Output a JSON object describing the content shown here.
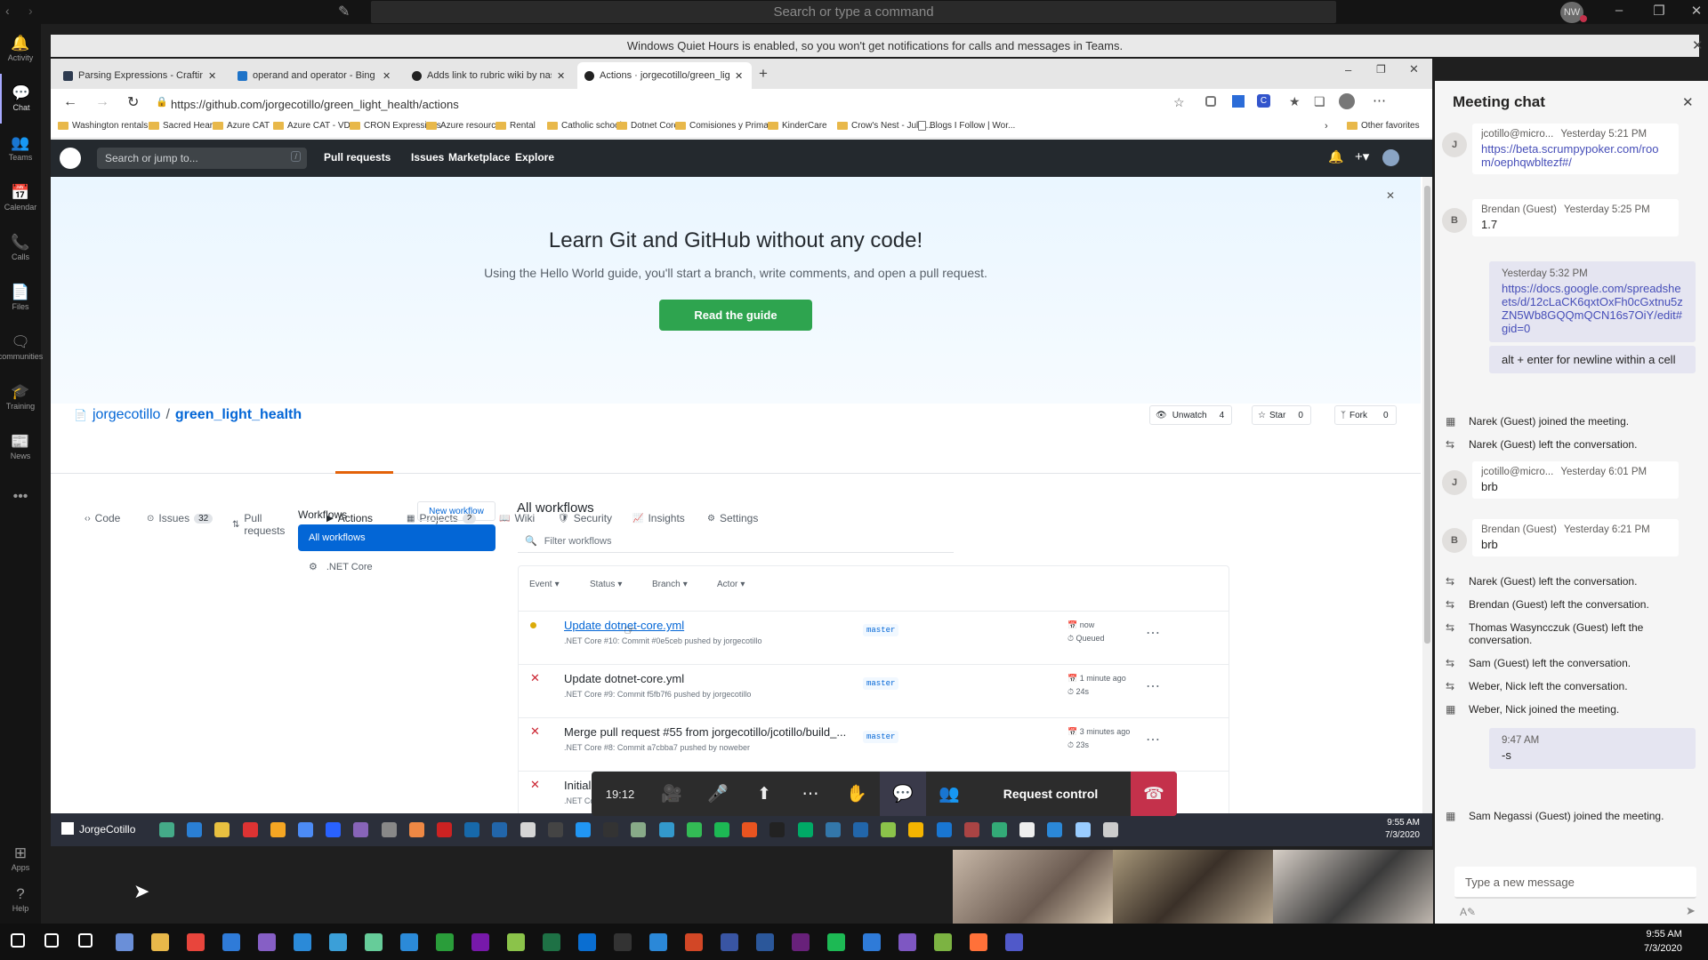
{
  "teams": {
    "search_placeholder": "Search or type a command",
    "user_initials": "NW",
    "quiet_banner": "Windows Quiet Hours is enabled, so you won't get notifications for calls and messages in Teams.",
    "rail": [
      {
        "label": "Activity",
        "icon": "bell-icon",
        "glyph": "🔔"
      },
      {
        "label": "Chat",
        "icon": "chat-icon",
        "glyph": "💬"
      },
      {
        "label": "Teams",
        "icon": "teams-icon",
        "glyph": "👥"
      },
      {
        "label": "Calendar",
        "icon": "calendar-icon",
        "glyph": "📅"
      },
      {
        "label": "Calls",
        "icon": "phone-icon",
        "glyph": "📞"
      },
      {
        "label": "Files",
        "icon": "file-icon",
        "glyph": "📄"
      },
      {
        "label": "communities",
        "icon": "communities-icon",
        "glyph": "🗨"
      },
      {
        "label": "Training",
        "icon": "training-icon",
        "glyph": "🎓"
      },
      {
        "label": "News",
        "icon": "news-icon",
        "glyph": "📰"
      }
    ],
    "rail_bottom": [
      {
        "label": "Apps",
        "icon": "apps-icon",
        "glyph": "⊞"
      },
      {
        "label": "Help",
        "icon": "help-icon",
        "glyph": "?"
      }
    ]
  },
  "browser": {
    "tabs": [
      {
        "title": "Parsing Expressions - Crafting Int"
      },
      {
        "title": "operand and operator - Bing"
      },
      {
        "title": "Adds link to rubric wiki by nasac"
      },
      {
        "title": "Actions · jorgecotillo/green_light"
      }
    ],
    "url": "https://github.com/jorgecotillo/green_light_health/actions",
    "favorites": [
      "Washington rentals",
      "Sacred Heart",
      "Azure CAT",
      "Azure CAT - VDC",
      "CRON Expressions",
      "Azure resources",
      "Rental",
      "Catholic schools",
      "Dotnet Core",
      "Comisiones y Prima...",
      "KinderCare",
      "Crow's Nest - July-...",
      "Blogs I Follow | Wor..."
    ],
    "other_favorites": "Other favorites"
  },
  "github": {
    "search_placeholder": "Search or jump to...",
    "nav": [
      "Pull requests",
      "Issues",
      "Marketplace",
      "Explore"
    ],
    "promo": {
      "title": "Learn Git and GitHub without any code!",
      "subtitle": "Using the Hello World guide, you'll start a branch, write comments, and open a pull request.",
      "button": "Read the guide"
    },
    "repo": {
      "owner": "jorgecotillo",
      "sep": "/",
      "name": "green_light_health",
      "unwatch": "Unwatch",
      "unwatch_count": "4",
      "star": "Star",
      "star_count": "0",
      "fork": "Fork",
      "fork_count": "0"
    },
    "tabs": [
      {
        "label": "Code",
        "count": ""
      },
      {
        "label": "Issues",
        "count": "32"
      },
      {
        "label": "Pull requests",
        "count": ""
      },
      {
        "label": "Actions",
        "count": ""
      },
      {
        "label": "Projects",
        "count": "2"
      },
      {
        "label": "Wiki",
        "count": ""
      },
      {
        "label": "Security",
        "count": ""
      },
      {
        "label": "Insights",
        "count": ""
      },
      {
        "label": "Settings",
        "count": ""
      }
    ],
    "workflows": {
      "heading": "Workflows",
      "new_button": "New workflow",
      "all_label": "All workflows",
      "items": [
        ".NET Core"
      ],
      "main_title": "All workflows",
      "filter_placeholder": "Filter workflows",
      "filters": [
        "Event",
        "Status",
        "Branch",
        "Actor"
      ],
      "runs": [
        {
          "title": "Update dotnet-core.yml",
          "meta": ".NET Core #10: Commit #0e5ceb pushed by jorgecotillo",
          "branch": "master",
          "when": "now",
          "duration": "Queued",
          "status": "queued"
        },
        {
          "title": "Update dotnet-core.yml",
          "meta": ".NET Core #9: Commit f5fb7f6 pushed by jorgecotillo",
          "branch": "master",
          "when": "1 minute ago",
          "duration": "24s",
          "status": "failed"
        },
        {
          "title": "Merge pull request #55 from jorgecotillo/jcotillo/build_...",
          "meta": ".NET Core #8: Commit a7cbba7 pushed by noweber",
          "branch": "master",
          "when": "3 minutes ago",
          "duration": "23s",
          "status": "failed"
        },
        {
          "title": "Initial Te",
          "meta": ".NET Core",
          "branch": "",
          "when": "",
          "duration": "",
          "status": "failed"
        }
      ]
    }
  },
  "call": {
    "time": "19:12",
    "request_control": "Request control"
  },
  "inner_taskbar": {
    "user": "JorgeCotillo",
    "time": "9:55 AM",
    "date": "7/3/2020"
  },
  "outer_taskbar": {
    "time": "9:55 AM",
    "date": "7/3/2020"
  },
  "chat": {
    "title": "Meeting chat",
    "messages": [
      {
        "kind": "msg",
        "avatar": "J",
        "author": "jcotillo@micro...",
        "time": "Yesterday 5:21 PM",
        "text": "https://beta.scrumpypoker.com/room/oephqwbltezf#/",
        "link": true
      },
      {
        "kind": "msg",
        "avatar": "B",
        "author": "Brendan (Guest)",
        "time": "Yesterday 5:25 PM",
        "text": "1.7",
        "link": false
      },
      {
        "kind": "self",
        "time": "Yesterday 5:32 PM",
        "text": "https://docs.google.com/spreadsheets/d/12cLaCK6qxtOxFh0cGxtnu5zZN5Wb8GQQmQCN16s7OiY/edit#gid=0",
        "link": true
      },
      {
        "kind": "self",
        "time": "",
        "text": "alt + enter for newline within a cell",
        "link": false
      },
      {
        "kind": "evt",
        "name": "Narek (Guest)",
        "text": " joined the meeting.",
        "icon": "join"
      },
      {
        "kind": "evt",
        "name": "Narek (Guest)",
        "text": " left the conversation.",
        "icon": "leave"
      },
      {
        "kind": "msg",
        "avatar": "J",
        "author": "jcotillo@micro...",
        "time": "Yesterday 6:01 PM",
        "text": "brb",
        "link": false
      },
      {
        "kind": "msg",
        "avatar": "B",
        "author": "Brendan (Guest)",
        "time": "Yesterday 6:21 PM",
        "text": "brb",
        "link": false
      },
      {
        "kind": "evt",
        "name": "Narek (Guest)",
        "text": " left the conversation.",
        "icon": "leave"
      },
      {
        "kind": "evt",
        "name": "Brendan (Guest)",
        "text": " left the conversation.",
        "icon": "leave"
      },
      {
        "kind": "evt",
        "name": "Thomas Wasyncczuk (Guest)",
        "text": " left the conversation.",
        "icon": "leave"
      },
      {
        "kind": "evt",
        "name": "Sam (Guest)",
        "text": " left the conversation.",
        "icon": "leave"
      },
      {
        "kind": "evt",
        "name": "Weber, Nick",
        "text": " left the conversation.",
        "icon": "leave"
      },
      {
        "kind": "evt",
        "name": "Weber, Nick",
        "text": " joined the meeting.",
        "icon": "join"
      },
      {
        "kind": "self",
        "time": "9:47 AM",
        "text": "-s",
        "link": false
      },
      {
        "kind": "evt",
        "name": "Sam Negassi (Guest)",
        "text": " joined the meeting.",
        "icon": "join"
      }
    ],
    "compose_placeholder": "Type a new message"
  }
}
